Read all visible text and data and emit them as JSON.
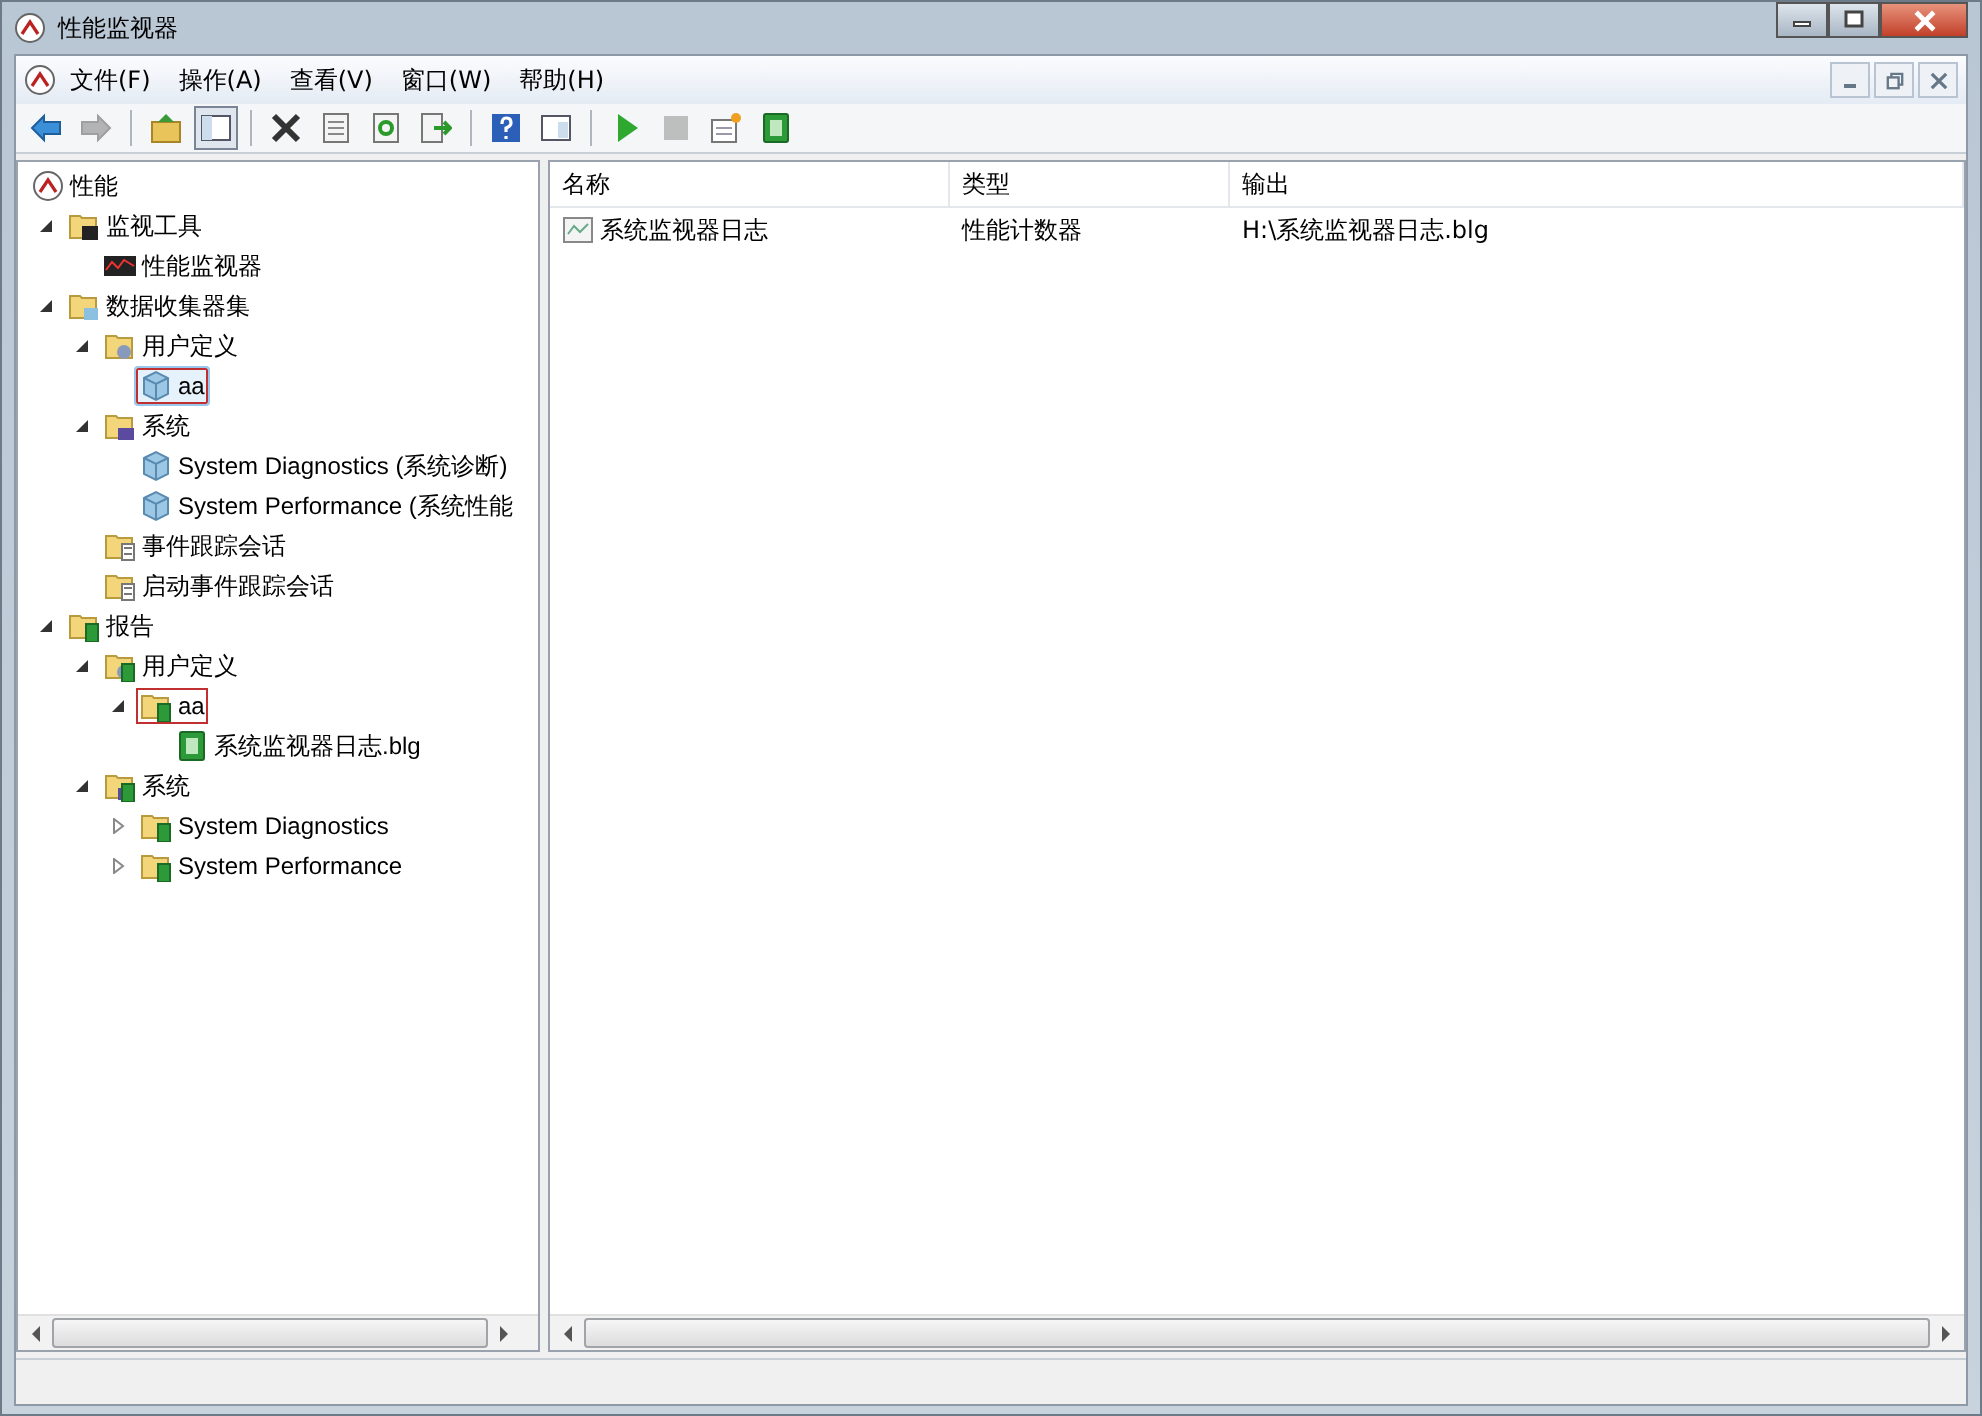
{
  "window": {
    "title": "性能监视器"
  },
  "menu": [
    {
      "label": "文件(F)"
    },
    {
      "label": "操作(A)"
    },
    {
      "label": "查看(V)"
    },
    {
      "label": "窗口(W)"
    },
    {
      "label": "帮助(H)"
    }
  ],
  "toolbar": [
    {
      "kind": "back",
      "pressed": false,
      "disabled": false
    },
    {
      "kind": "forward",
      "pressed": false,
      "disabled": true
    },
    {
      "kind": "sep"
    },
    {
      "kind": "up",
      "pressed": false,
      "disabled": false
    },
    {
      "kind": "tree",
      "pressed": true,
      "disabled": false
    },
    {
      "kind": "sep"
    },
    {
      "kind": "delete",
      "pressed": false,
      "disabled": false
    },
    {
      "kind": "props",
      "pressed": false,
      "disabled": false
    },
    {
      "kind": "refresh",
      "pressed": false,
      "disabled": false
    },
    {
      "kind": "export",
      "pressed": false,
      "disabled": false
    },
    {
      "kind": "sep"
    },
    {
      "kind": "help",
      "pressed": false,
      "disabled": false
    },
    {
      "kind": "pane",
      "pressed": false,
      "disabled": false
    },
    {
      "kind": "sep"
    },
    {
      "kind": "start",
      "pressed": false,
      "disabled": false
    },
    {
      "kind": "stop",
      "pressed": false,
      "disabled": true
    },
    {
      "kind": "new",
      "pressed": false,
      "disabled": false
    },
    {
      "kind": "report",
      "pressed": false,
      "disabled": false
    }
  ],
  "tree": [
    {
      "label": "性能",
      "kind": "perf",
      "selected": false,
      "highlighted": false,
      "children": [
        {
          "label": "监视工具",
          "kind": "tools",
          "expanded": true,
          "selected": false,
          "highlighted": false,
          "children": [
            {
              "label": "性能监视器",
              "kind": "monitor",
              "selected": false,
              "highlighted": false
            }
          ]
        },
        {
          "label": "数据收集器集",
          "kind": "dcs",
          "expanded": true,
          "selected": false,
          "highlighted": false,
          "children": [
            {
              "label": "用户定义",
              "kind": "user",
              "expanded": true,
              "selected": false,
              "highlighted": false,
              "children": [
                {
                  "label": "aa",
                  "kind": "cube",
                  "selected": true,
                  "highlighted": true
                }
              ]
            },
            {
              "label": "系统",
              "kind": "system",
              "expanded": true,
              "selected": false,
              "highlighted": false,
              "children": [
                {
                  "label": "System Diagnostics (系统诊断)",
                  "kind": "cube",
                  "selected": false,
                  "highlighted": false
                },
                {
                  "label": "System Performance (系统性能",
                  "kind": "cube",
                  "selected": false,
                  "highlighted": false
                }
              ]
            },
            {
              "label": "事件跟踪会话",
              "kind": "trace",
              "selected": false,
              "highlighted": false
            },
            {
              "label": "启动事件跟踪会话",
              "kind": "trace",
              "selected": false,
              "highlighted": false
            }
          ]
        },
        {
          "label": "报告",
          "kind": "report",
          "expanded": true,
          "selected": false,
          "highlighted": false,
          "children": [
            {
              "label": "用户定义",
              "kind": "report-user",
              "expanded": true,
              "selected": false,
              "highlighted": false,
              "children": [
                {
                  "label": "aa",
                  "kind": "report",
                  "expanded": true,
                  "selected": false,
                  "highlighted": true,
                  "children": [
                    {
                      "label": "系统监视器日志.blg",
                      "kind": "log",
                      "selected": false,
                      "highlighted": false
                    }
                  ]
                }
              ]
            },
            {
              "label": "系统",
              "kind": "report-system",
              "expanded": true,
              "selected": false,
              "highlighted": false,
              "children": [
                {
                  "label": "System Diagnostics",
                  "kind": "report",
                  "expanded": false,
                  "selected": false,
                  "highlighted": false
                },
                {
                  "label": "System Performance",
                  "kind": "report",
                  "expanded": false,
                  "selected": false,
                  "highlighted": false
                }
              ]
            }
          ]
        }
      ]
    }
  ],
  "table": {
    "columns": [
      "名称",
      "类型",
      "输出"
    ],
    "rows": [
      {
        "cells": [
          "系统监视器日志",
          "性能计数器",
          "H:\\系统监视器日志.blg"
        ]
      }
    ]
  }
}
